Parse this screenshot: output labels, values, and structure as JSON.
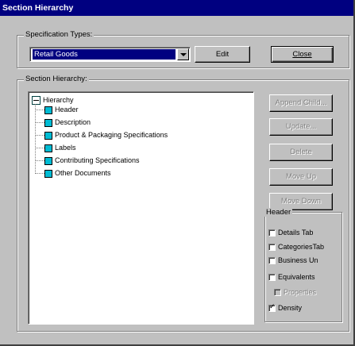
{
  "window": {
    "title": "Section Hierarchy"
  },
  "spec_types": {
    "group_label": "Specification Types:",
    "selected": "Retail Goods",
    "edit_label": "Edit",
    "close_label": "Close"
  },
  "section_hierarchy": {
    "group_label": "Section Hierarchy:",
    "root": "Hierarchy",
    "items": [
      "Header",
      "Description",
      "Product & Packaging Specifications",
      "Labels",
      "Contributing Specifications",
      "Other Documents"
    ]
  },
  "actions": {
    "append_child": "Append Child...",
    "update": "Update...",
    "delete": "Delete",
    "move_up": "Move Up",
    "move_down": "Move Down"
  },
  "header_options": {
    "group_label": "Header",
    "checkboxes": [
      {
        "label": "Details Tab",
        "checked": false,
        "enabled": true
      },
      {
        "label": "CategoriesTab",
        "checked": false,
        "enabled": true
      },
      {
        "label": "Business Un",
        "checked": false,
        "enabled": true
      },
      {
        "label": "Equivalents",
        "checked": false,
        "enabled": true
      },
      {
        "label": "Properties",
        "checked": false,
        "enabled": false
      },
      {
        "label": "Density",
        "checked": true,
        "enabled": true
      }
    ]
  },
  "colors": {
    "titlebar": "#000080",
    "face": "#c0c0c0",
    "item_icon": "#00bcd4"
  }
}
